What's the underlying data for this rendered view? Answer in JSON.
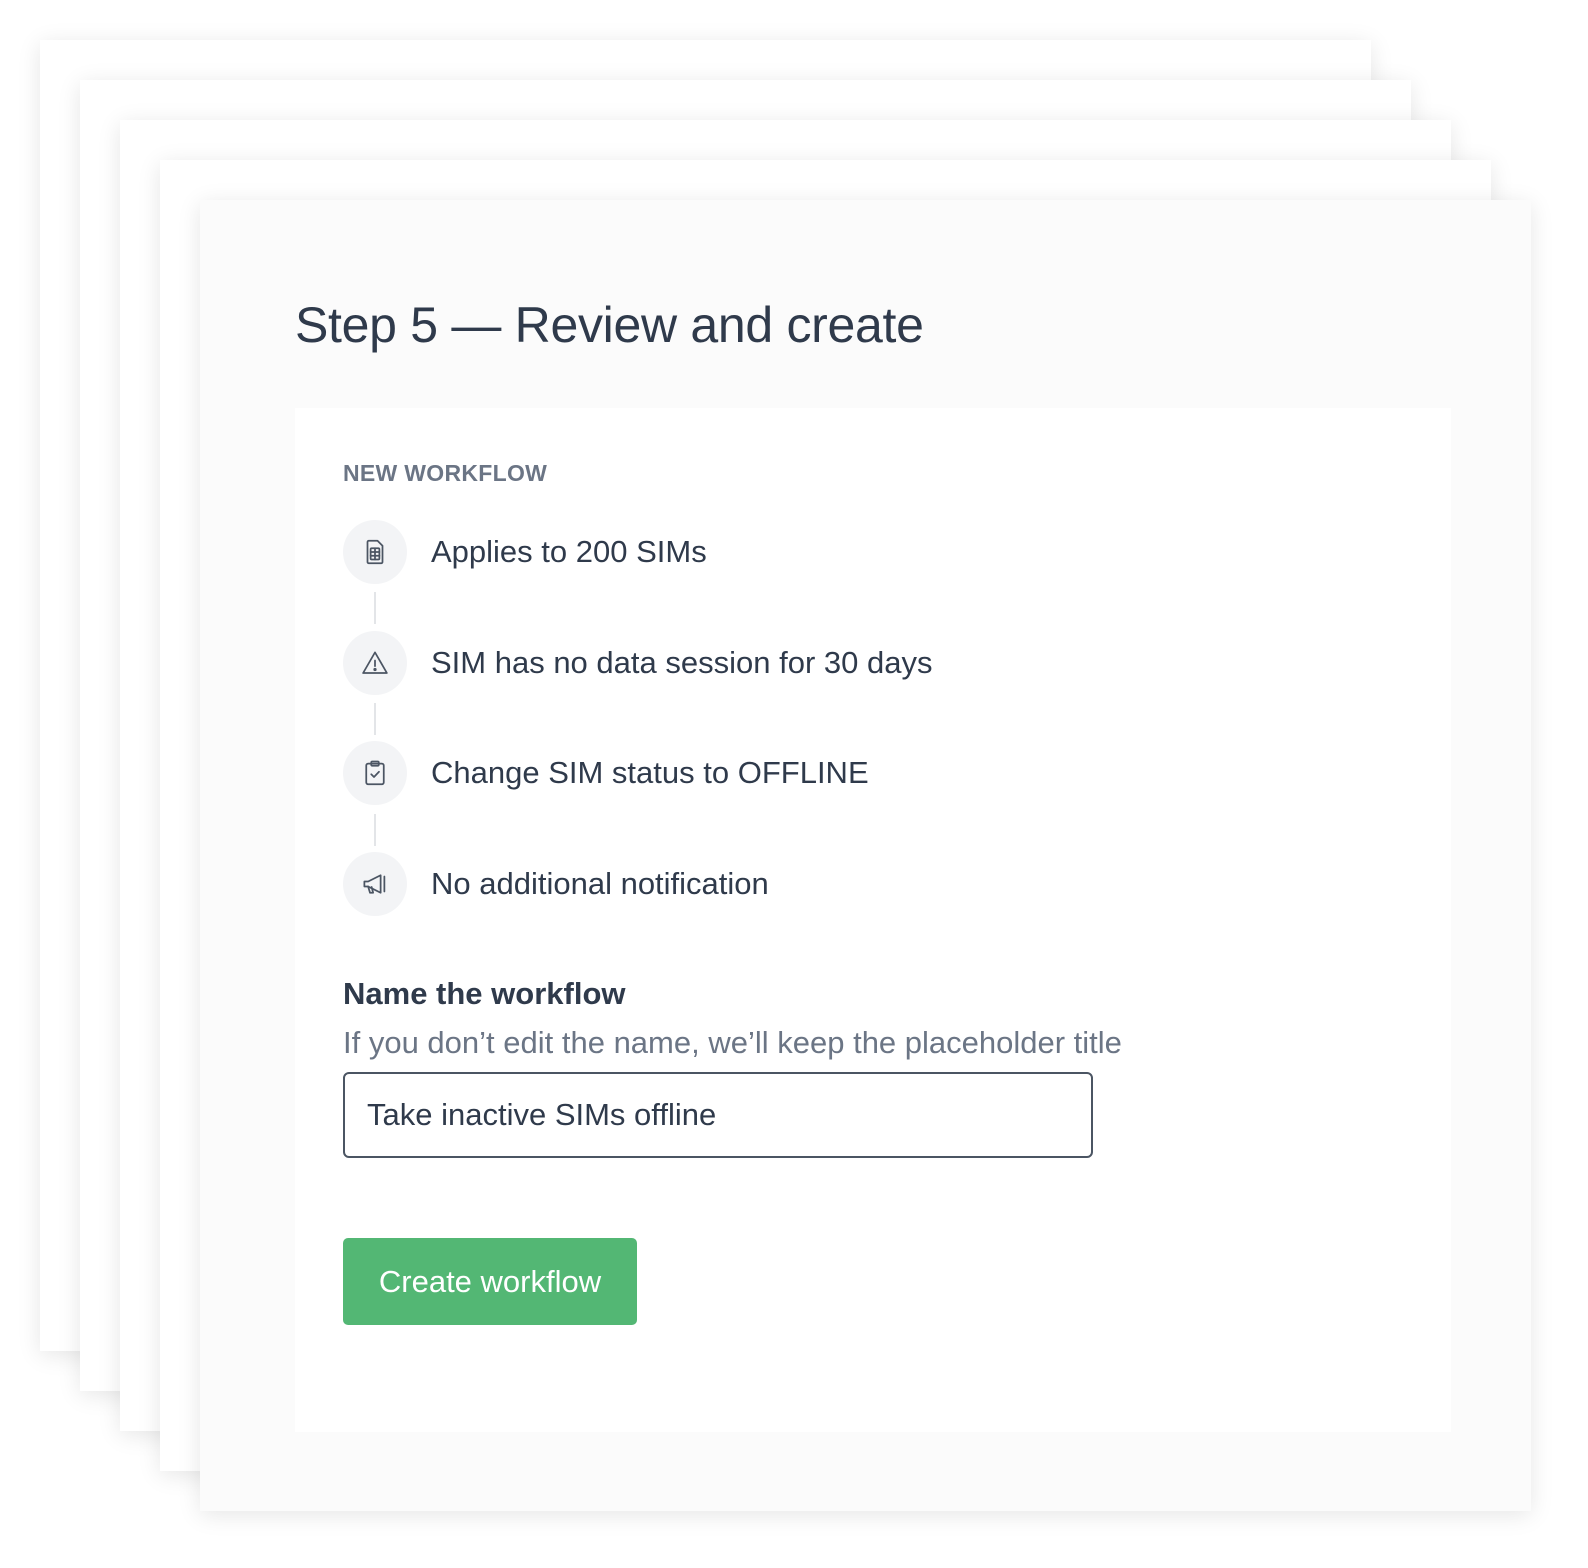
{
  "step": {
    "title": "Step 5 — Review and create"
  },
  "summary": {
    "eyebrow": "NEW WORKFLOW",
    "items": [
      {
        "icon": "sim-card-icon",
        "text": "Applies to 200 SIMs"
      },
      {
        "icon": "warning-triangle-icon",
        "text": "SIM has no data session for 30 days"
      },
      {
        "icon": "clipboard-check-icon",
        "text": "Change SIM status to OFFLINE"
      },
      {
        "icon": "megaphone-icon",
        "text": "No additional notification"
      }
    ]
  },
  "name_field": {
    "label": "Name the workflow",
    "hint": "If you don’t edit the name, we’ll keep the placeholder title",
    "value": "Take inactive SIMs offline"
  },
  "actions": {
    "create_label": "Create workflow"
  },
  "colors": {
    "primary_button": "#53b774",
    "heading_text": "#2f3a4b",
    "muted_text": "#6b7585",
    "icon_circle": "#f3f4f6"
  }
}
